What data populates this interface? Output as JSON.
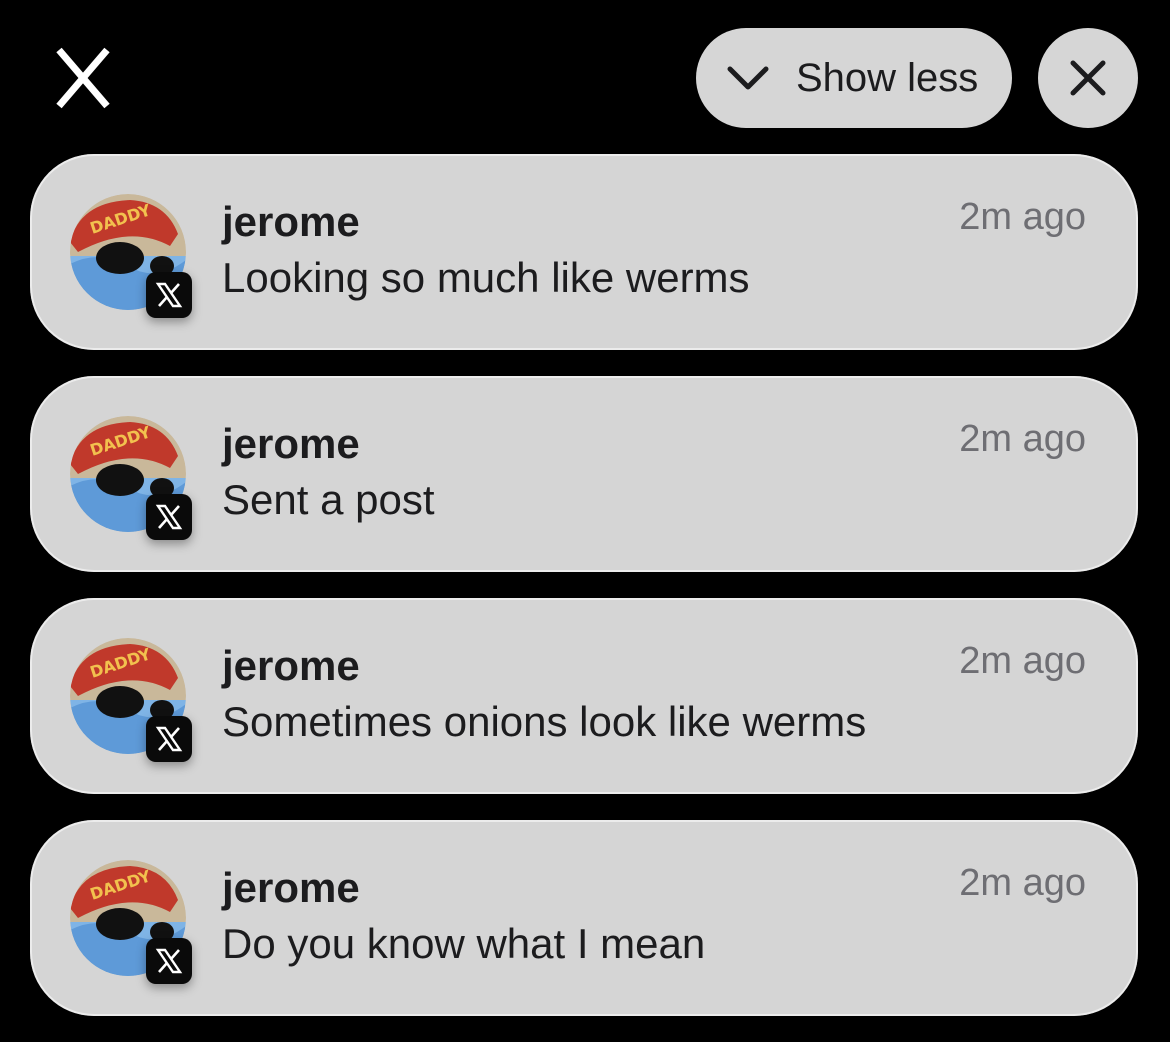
{
  "header": {
    "show_less_label": "Show less",
    "app_logo_icon": "x-logo-icon",
    "chevron_icon": "chevron-down-icon",
    "close_icon": "close-icon"
  },
  "notifications": [
    {
      "sender": "jerome",
      "message": "Looking so much like werms",
      "time": "2m ago",
      "avatar_text": "DADDY"
    },
    {
      "sender": "jerome",
      "message": "Sent a post",
      "time": "2m ago",
      "avatar_text": "DADDY"
    },
    {
      "sender": "jerome",
      "message": "Sometimes onions look like werms",
      "time": "2m ago",
      "avatar_text": "DADDY"
    },
    {
      "sender": "jerome",
      "message": "Do you know what I mean",
      "time": "2m ago",
      "avatar_text": "DADDY"
    }
  ],
  "colors": {
    "background": "#000000",
    "card": "#d5d5d5",
    "button": "#d6d6d6",
    "text_primary": "#1c1c1e",
    "text_secondary": "#6e6e73",
    "badge": "#0a0a0a"
  }
}
